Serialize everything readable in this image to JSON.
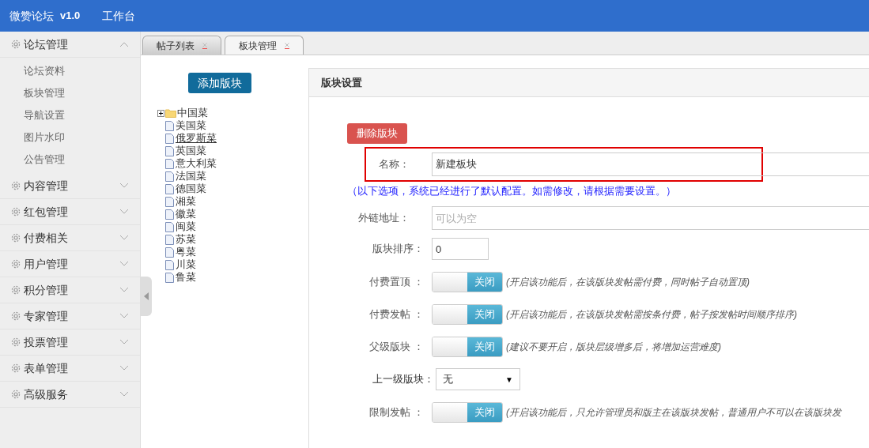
{
  "header": {
    "brand": "微赞论坛",
    "version": "v1.0",
    "nav": "工作台"
  },
  "sidebar": {
    "groups": [
      {
        "label": "论坛管理",
        "expanded": true,
        "children": [
          {
            "label": "论坛资料"
          },
          {
            "label": "板块管理"
          },
          {
            "label": "导航设置"
          },
          {
            "label": "图片水印"
          },
          {
            "label": "公告管理"
          }
        ]
      },
      {
        "label": "内容管理",
        "expanded": false
      },
      {
        "label": "红包管理",
        "expanded": false
      },
      {
        "label": "付费相关",
        "expanded": false
      },
      {
        "label": "用户管理",
        "expanded": false
      },
      {
        "label": "积分管理",
        "expanded": false
      },
      {
        "label": "专家管理",
        "expanded": false
      },
      {
        "label": "投票管理",
        "expanded": false
      },
      {
        "label": "表单管理",
        "expanded": false
      },
      {
        "label": "高级服务",
        "expanded": false
      }
    ]
  },
  "tabs": [
    {
      "label": "帖子列表",
      "selected": false
    },
    {
      "label": "板块管理",
      "selected": true
    }
  ],
  "tree": {
    "add_button": "添加版块",
    "nodes": [
      {
        "label": "中国菜",
        "kind": "folder",
        "expanded": false,
        "hovered": false
      },
      {
        "label": "美国菜",
        "kind": "file",
        "hovered": false
      },
      {
        "label": "俄罗斯菜",
        "kind": "file",
        "hovered": true
      },
      {
        "label": "英国菜",
        "kind": "file",
        "hovered": false
      },
      {
        "label": "意大利菜",
        "kind": "file",
        "hovered": false
      },
      {
        "label": "法国菜",
        "kind": "file",
        "hovered": false
      },
      {
        "label": "德国菜",
        "kind": "file",
        "hovered": false
      },
      {
        "label": "湘菜",
        "kind": "file",
        "hovered": false
      },
      {
        "label": "徽菜",
        "kind": "file",
        "hovered": false
      },
      {
        "label": "闽菜",
        "kind": "file",
        "hovered": false
      },
      {
        "label": "苏菜",
        "kind": "file",
        "hovered": false
      },
      {
        "label": "粤菜",
        "kind": "file",
        "hovered": false
      },
      {
        "label": "川菜",
        "kind": "file",
        "hovered": false
      },
      {
        "label": "鲁菜",
        "kind": "file",
        "hovered": false
      }
    ]
  },
  "settings": {
    "title": "版块设置",
    "delete_button": "删除版块",
    "notice": "（以下选项，系统已经进行了默认配置。如需修改，请根据需要设置。）",
    "fields": [
      {
        "kind": "text",
        "label": "名称：",
        "value": "新建板块",
        "highlighted": true
      },
      {
        "kind": "notice"
      },
      {
        "kind": "text",
        "label": "外链地址：",
        "placeholder": "可以为空",
        "highlighted": false
      },
      {
        "kind": "short",
        "label": "版块排序：",
        "value": "0"
      },
      {
        "kind": "toggle",
        "label": "付费置顶 ：",
        "on": false,
        "state_label": "关闭",
        "hint": "(开启该功能后，在该版块发帖需付费，同时帖子自动置顶)"
      },
      {
        "kind": "toggle",
        "label": "付费发帖 ：",
        "on": false,
        "state_label": "关闭",
        "hint": "(开启该功能后，在该版块发帖需按条付费，帖子按发帖时间顺序排序)"
      },
      {
        "kind": "toggle",
        "label": "父级版块 ：",
        "on": false,
        "state_label": "关闭",
        "hint": "(建议不要开启，版块层级增多后，将增加运营难度)"
      },
      {
        "kind": "select",
        "label": "上一级版块：",
        "value": "无",
        "caret": "▼"
      },
      {
        "kind": "toggle",
        "label": "限制发帖 ：",
        "on": false,
        "state_label": "关闭",
        "hint": "(开启该功能后，只允许管理员和版主在该版块发帖，普通用户不可以在该版块发"
      }
    ]
  }
}
